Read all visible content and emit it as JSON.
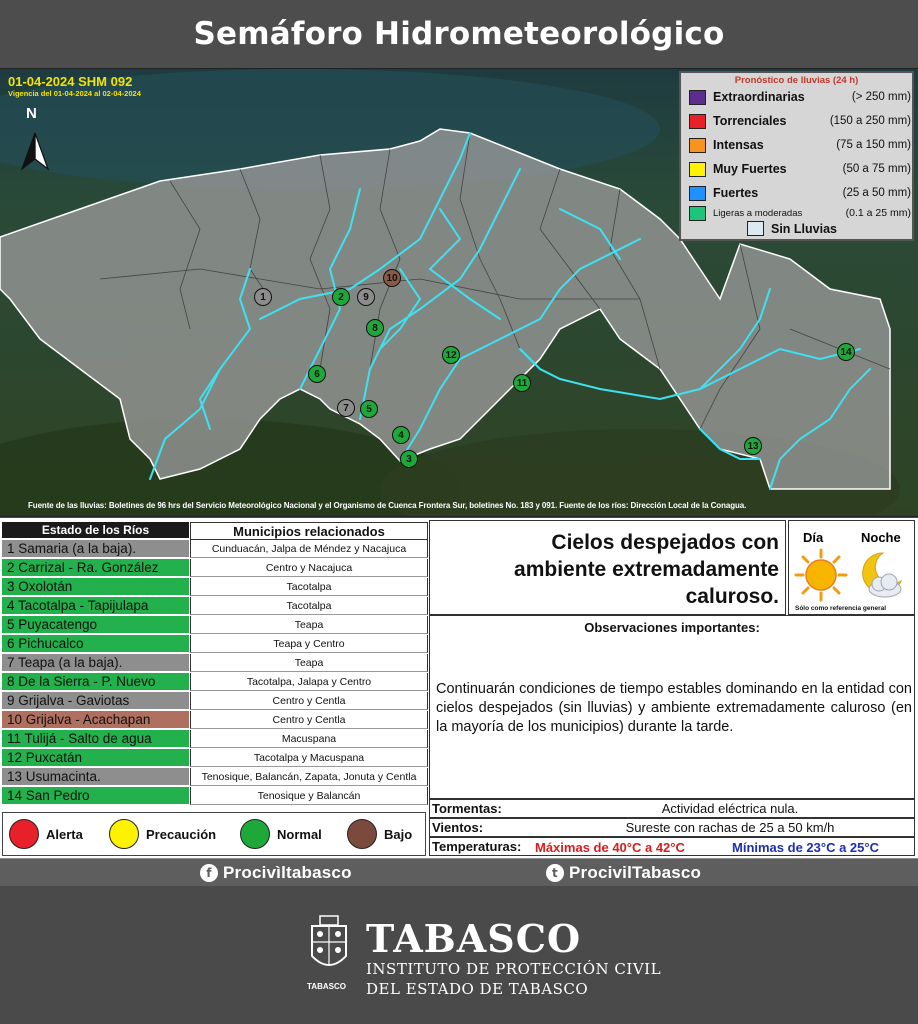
{
  "header": {
    "title": "Semáforo Hidrometeorológico"
  },
  "map": {
    "date_code": "01-04-2024 SHM 092",
    "validity": "Vigencia del 01-04-2024 al 02-04-2024",
    "north_label": "N",
    "source": "Fuente de las lluvias: Boletines de 96 hrs del Servicio Meteorológico Nacional y el Organismo de Cuenca Frontera Sur, boletines No. 183 y 091. Fuente de los ríos: Dirección Local de la Conagua.",
    "legend": {
      "title": "Pronóstico de lluvias (24 h)",
      "items": [
        {
          "label": "Extraordinarias",
          "range": "(> 250 mm)",
          "color": "#5b2d8e"
        },
        {
          "label": "Torrenciales",
          "range": "(150 a 250 mm)",
          "color": "#e8202a"
        },
        {
          "label": "Intensas",
          "range": "(75 a 150 mm)",
          "color": "#f7941d"
        },
        {
          "label": "Muy Fuertes",
          "range": "(50 a 75 mm)",
          "color": "#fff200"
        },
        {
          "label": "Fuertes",
          "range": "(25 a 50 mm)",
          "color": "#1e90ff"
        },
        {
          "label": "Ligeras a moderadas",
          "range": "(0.1 a 25 mm)",
          "color": "#1dc47a"
        }
      ],
      "none_label": "Sin Lluvias"
    },
    "markers": [
      {
        "n": "1",
        "status": "gray"
      },
      {
        "n": "2",
        "status": "green"
      },
      {
        "n": "9",
        "status": "gray"
      },
      {
        "n": "10",
        "status": "brown"
      },
      {
        "n": "8",
        "status": "green"
      },
      {
        "n": "12",
        "status": "green"
      },
      {
        "n": "6",
        "status": "green"
      },
      {
        "n": "11",
        "status": "green"
      },
      {
        "n": "7",
        "status": "gray"
      },
      {
        "n": "5",
        "status": "green"
      },
      {
        "n": "4",
        "status": "green"
      },
      {
        "n": "3",
        "status": "green"
      },
      {
        "n": "14",
        "status": "green"
      },
      {
        "n": "13",
        "status": "green"
      }
    ]
  },
  "rivers": {
    "title": "Estado de los Ríos",
    "rows": [
      {
        "name": "1 Samaria (a la baja).",
        "status": "gray"
      },
      {
        "name": "2 Carrizal - Ra. González",
        "status": "green"
      },
      {
        "name": "3 Oxolotán",
        "status": "green"
      },
      {
        "name": "4 Tacotalpa - Tapijulapa",
        "status": "green"
      },
      {
        "name": "5 Puyacatengo",
        "status": "green"
      },
      {
        "name": "6 Pichucalco",
        "status": "green"
      },
      {
        "name": "7 Teapa (a la baja).",
        "status": "gray"
      },
      {
        "name": "8 De la Sierra - P. Nuevo",
        "status": "green"
      },
      {
        "name": "9 Grijalva - Gaviotas",
        "status": "gray"
      },
      {
        "name": "10 Grijalva - Acachapan",
        "status": "brown"
      },
      {
        "name": "11 Tulijá - Salto de agua",
        "status": "green"
      },
      {
        "name": "12 Puxcatán",
        "status": "green"
      },
      {
        "name": "13 Usumacinta.",
        "status": "gray"
      },
      {
        "name": "14 San Pedro",
        "status": "green"
      }
    ]
  },
  "municipios": {
    "title": "Municipios relacionados",
    "rows": [
      "Cunduacán, Jalpa de Méndez y Nacajuca",
      "Centro y Nacajuca",
      "Tacotalpa",
      "Tacotalpa",
      "Teapa",
      "Teapa y Centro",
      "Teapa",
      "Tacotalpa, Jalapa y Centro",
      "Centro y Centla",
      "Centro y Centla",
      "Macuspana",
      "Tacotalpa y Macuspana",
      "Tenosique, Balancán, Zapata, Jonuta y Centla",
      "Tenosique y Balancán"
    ]
  },
  "status_legend": [
    {
      "label": "Alerta",
      "color": "#e8202a"
    },
    {
      "label": "Precaución",
      "color": "#fff200"
    },
    {
      "label": "Normal",
      "color": "#1fa83a"
    },
    {
      "label": "Bajo",
      "color": "#7b4a3c"
    }
  ],
  "sky": {
    "line1": "Cielos despejados con",
    "line2": "ambiente extremadamente",
    "line3": "caluroso."
  },
  "daynight": {
    "day": "Día",
    "night": "Noche",
    "note": "Sólo como referencia general"
  },
  "observations": {
    "title": "Observaciones importantes:",
    "text": "Continuarán condiciones de tiempo estables dominando en la entidad con cielos despejados (sin lluvias) y ambiente extremadamente caluroso (en la mayoría de los municipios) durante la tarde."
  },
  "weather": {
    "storms_label": "Tormentas:",
    "storms_value": "Actividad eléctrica nula.",
    "winds_label": "Vientos:",
    "winds_value": "Sureste con rachas de 25 a 50 km/h",
    "temps_label": "Temperaturas:",
    "temps_max": "Máximas de 40°C a 42°C",
    "temps_min": "Mínimas de 23°C a 25°C"
  },
  "social": {
    "facebook": "Procivìltabasco",
    "twitter": "ProcivilTabasco"
  },
  "footer": {
    "name": "TABASCO",
    "line1": "INSTITUTO DE PROTECCIÓN CIVIL",
    "line2": "DEL ESTADO DE TABASCO",
    "seal_caption": "TABASCO"
  },
  "colors": {
    "green": "#22b14c",
    "gray": "#8e8e8e",
    "brown": "#b07060",
    "river": "#3fe0f0"
  }
}
